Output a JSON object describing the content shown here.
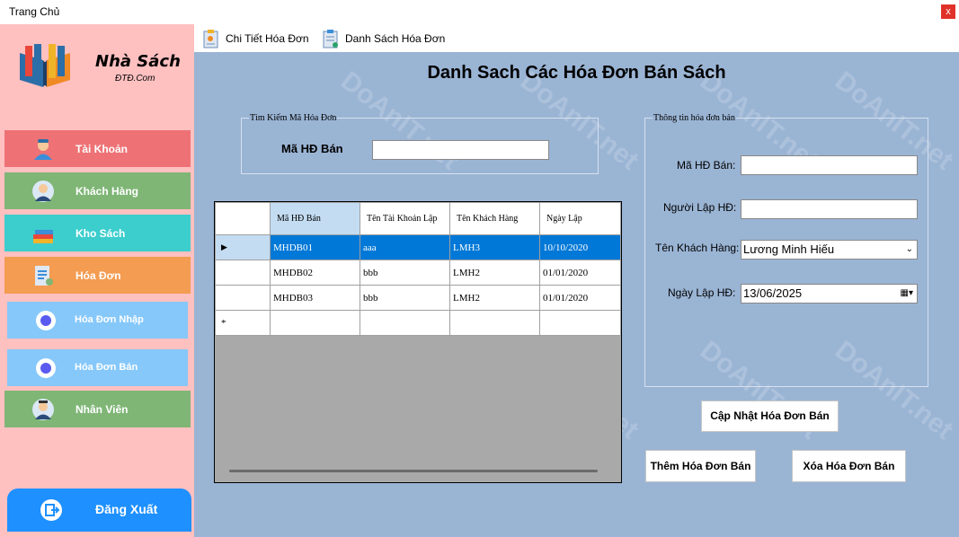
{
  "window": {
    "title": "Trang Chủ",
    "close_glyph": "x"
  },
  "sidebar": {
    "brand": "Nhà Sách",
    "brand_sub": "ĐTĐ.Com",
    "items": [
      {
        "label": "Tài Khoản",
        "color": "#ee7275",
        "icon": "user-account-icon"
      },
      {
        "label": "Khách Hàng",
        "color": "#7fb676",
        "icon": "customer-icon"
      },
      {
        "label": "Kho Sách",
        "color": "#3ccdcd",
        "icon": "books-icon"
      },
      {
        "label": "Hóa Đơn",
        "color": "#f49c51",
        "icon": "invoice-icon"
      },
      {
        "label": "Hóa Đơn Nhập",
        "color": "#86c8fa",
        "icon": "radio-icon"
      },
      {
        "label": "Hóa Đơn Bán",
        "color": "#86c8fa",
        "icon": "radio-icon"
      },
      {
        "label": "Nhân Viên",
        "color": "#7fb676",
        "icon": "staff-icon"
      }
    ],
    "logout": "Đăng Xuất"
  },
  "toolbar": {
    "detail": "Chi Tiết Hóa Đơn",
    "list": "Danh Sách Hóa Đơn"
  },
  "main": {
    "heading": "Danh Sach Các Hóa Đơn Bán Sách",
    "search": {
      "legend": "Tìm Kiếm Mã Hóa Đơn",
      "label": "Mã HĐ Bán",
      "value": ""
    },
    "info": {
      "legend": "Thông tin hóa đơn bán",
      "ma_label": "Mã HĐ Bán:",
      "ma_value": "",
      "nguoi_label": "Người Lập HĐ:",
      "nguoi_value": "",
      "khach_label": "Tên Khách Hàng:",
      "khach_value": "Lương Minh Hiếu",
      "ngay_label": "Ngày Lập HĐ:",
      "ngay_value": "13/06/2025"
    },
    "buttons": {
      "update": "Cập Nhật Hóa Đơn Bán",
      "add": "Thêm Hóa Đơn Bán",
      "delete": "Xóa Hóa Đơn Bán"
    },
    "grid": {
      "columns": [
        "Mã HĐ Bán",
        "Tên Tài Khoản Lập",
        "Tên Khách Hàng",
        "Ngày Lập"
      ],
      "rows": [
        [
          "MHDB01",
          "aaa",
          "LMH3",
          "10/10/2020"
        ],
        [
          "MHDB02",
          "bbb",
          "LMH2",
          "01/01/2020"
        ],
        [
          "MHDB03",
          "bbb",
          "LMH2",
          "01/01/2020"
        ]
      ],
      "new_row_marker": "*"
    }
  },
  "watermark": "DoAnIT.net"
}
